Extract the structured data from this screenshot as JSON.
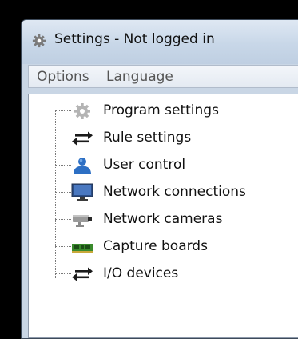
{
  "window": {
    "title": "Settings - Not logged in",
    "title_icon": "gear-icon"
  },
  "menu": {
    "items": [
      {
        "label": "Options"
      },
      {
        "label": "Language"
      }
    ]
  },
  "tree": {
    "items": [
      {
        "label": "Program settings",
        "icon": "gear-icon"
      },
      {
        "label": "Rule settings",
        "icon": "swap-arrows-icon"
      },
      {
        "label": "User control",
        "icon": "user-icon"
      },
      {
        "label": "Network connections",
        "icon": "monitor-icon"
      },
      {
        "label": "Network cameras",
        "icon": "camera-icon"
      },
      {
        "label": "Capture boards",
        "icon": "capture-board-icon"
      },
      {
        "label": "I/O devices",
        "icon": "swap-arrows-icon"
      }
    ]
  },
  "colors": {
    "titlebar": "#c8d7e8",
    "accent_user": "#2d6fc4",
    "capture_board_green": "#3a8a2c"
  }
}
